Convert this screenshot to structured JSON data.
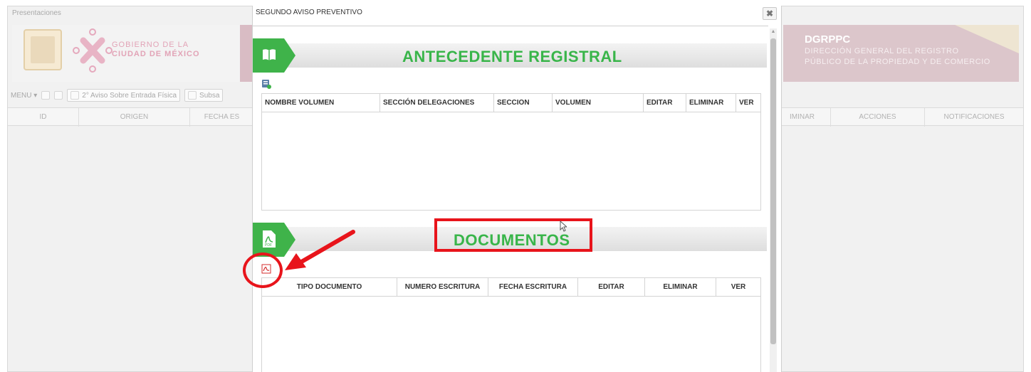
{
  "background": {
    "title": "Presentaciones",
    "gov_line1": "GOBIERNO DE LA",
    "gov_line2": "CIUDAD DE MÉXICO",
    "dgrppc_title": "DGRPPC",
    "dgrppc_line1": "DIRECCIÓN GENERAL DEL REGISTRO",
    "dgrppc_line2": "PÚBLICO DE LA PROPIEDAD Y DE COMERCIO",
    "toolbar": {
      "menu_label": "MENU",
      "aviso_label": "2° Aviso Sobre Entrada Física",
      "subsa_label": "Subsa"
    },
    "grid_columns": {
      "id": "ID",
      "origen": "ORIGEN",
      "fecha": "FECHA ES",
      "eliminar": "IMINAR",
      "acciones": "ACCIONES",
      "notificaciones": "NOTIFICACIONES"
    }
  },
  "modal": {
    "title": "SEGUNDO AVISO PREVENTIVO",
    "close_glyph": "✖",
    "antecedente": {
      "title": "ANTECEDENTE REGISTRAL",
      "columns": [
        "NOMBRE VOLUMEN",
        "SECCIÓN DELEGACIONES",
        "SECCION",
        "VOLUMEN",
        "EDITAR",
        "ELIMINAR",
        "VER"
      ]
    },
    "documentos": {
      "title": "DOCUMENTOS",
      "columns": [
        "TIPO DOCUMENTO",
        "NUMERO ESCRITURA",
        "FECHA ESCRITURA",
        "EDITAR",
        "ELIMINAR",
        "VER"
      ]
    }
  },
  "colors": {
    "accent_green": "#39b54a",
    "annotation_red": "#e8141b",
    "brand_pink": "#d9a2b4"
  }
}
